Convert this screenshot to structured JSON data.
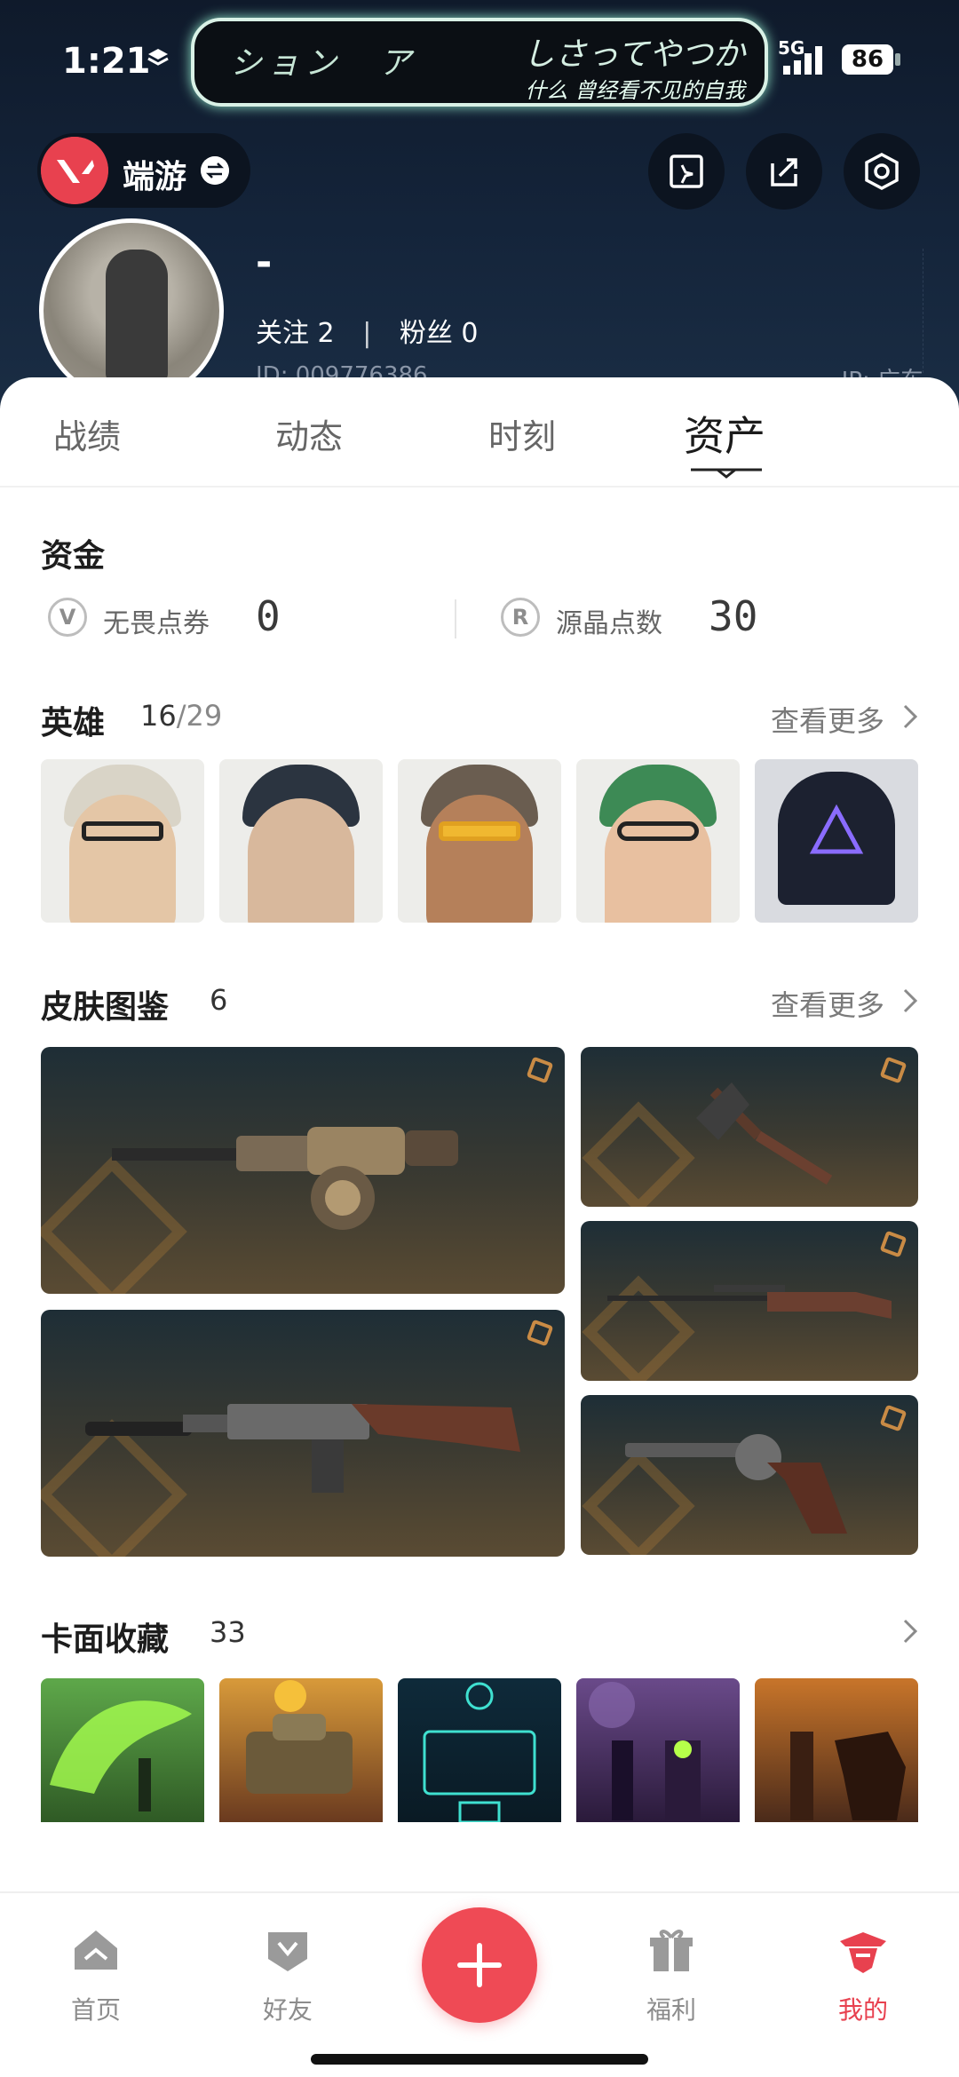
{
  "status_bar": {
    "time": "1:21",
    "network": "5G",
    "battery": "86",
    "island_left": "ション　ア",
    "island_right_top": "しさってやつか",
    "island_right_bottom": "什么 曾经看不见的自我"
  },
  "profile": {
    "game_name": "端游",
    "username": "-",
    "follow_label": "关注",
    "follow_count": "2",
    "fans_label": "粉丝",
    "fans_count": "0",
    "id_text": "ID: 009776386",
    "ip_text": "IP: 广东"
  },
  "tabs": [
    {
      "label": "战绩"
    },
    {
      "label": "动态"
    },
    {
      "label": "时刻"
    },
    {
      "label": "资产",
      "active": true
    }
  ],
  "funds": {
    "title": "资金",
    "items": [
      {
        "icon": "valorant-points-icon",
        "label": "无畏点券",
        "value": "0"
      },
      {
        "icon": "radianite-points-icon",
        "label": "源晶点数",
        "value": "30"
      }
    ]
  },
  "heroes": {
    "title": "英雄",
    "owned": "16",
    "separator": "/",
    "total": "29",
    "see_more": "查看更多"
  },
  "skins": {
    "title": "皮肤图鉴",
    "count": "6",
    "see_more": "查看更多"
  },
  "cards": {
    "title": "卡面收藏",
    "count": "33"
  },
  "bottom_nav": [
    {
      "label": "首页",
      "icon": "home-icon"
    },
    {
      "label": "好友",
      "icon": "friends-icon"
    },
    {
      "label": "福利",
      "icon": "gift-icon"
    },
    {
      "label": "我的",
      "icon": "profile-icon",
      "active": true
    }
  ],
  "colors": {
    "accent": "#ef4a55",
    "header_bg": "#14243a"
  }
}
